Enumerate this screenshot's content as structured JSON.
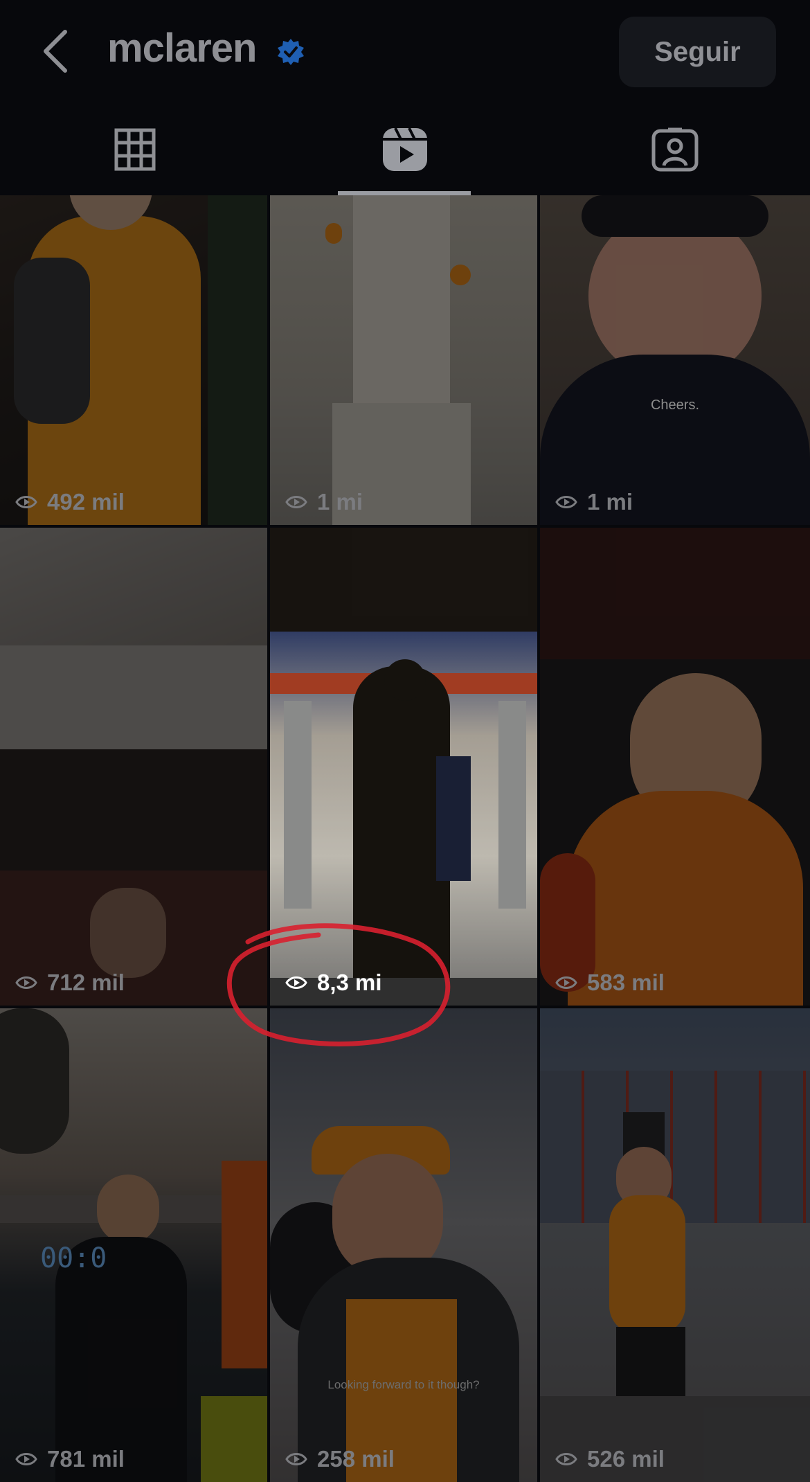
{
  "header": {
    "username": "mclaren",
    "follow_label": "Seguir"
  },
  "icons": {
    "back": "chevron-left-icon",
    "verified": "verified-badge-icon",
    "grid_tab": "grid-icon",
    "reels_tab": "reels-icon",
    "tagged_tab": "tagged-person-icon",
    "views": "eye-play-icon"
  },
  "colors": {
    "verified": "#1f5fb3",
    "annotation": "#d8202f",
    "accent_orange": "#e5891c"
  },
  "tabs": {
    "active": "reels"
  },
  "reels": [
    {
      "views": "492 mil"
    },
    {
      "views": "1 mi"
    },
    {
      "views": "1 mi",
      "caption": "Cheers."
    },
    {
      "views": "712 mil"
    },
    {
      "views": "8,3 mi",
      "highlighted": true
    },
    {
      "views": "583 mil"
    },
    {
      "views": "781 mil",
      "overlay_text": "00:0"
    },
    {
      "views": "258 mil",
      "caption": "Looking forward to it though?"
    },
    {
      "views": "526 mil"
    }
  ]
}
